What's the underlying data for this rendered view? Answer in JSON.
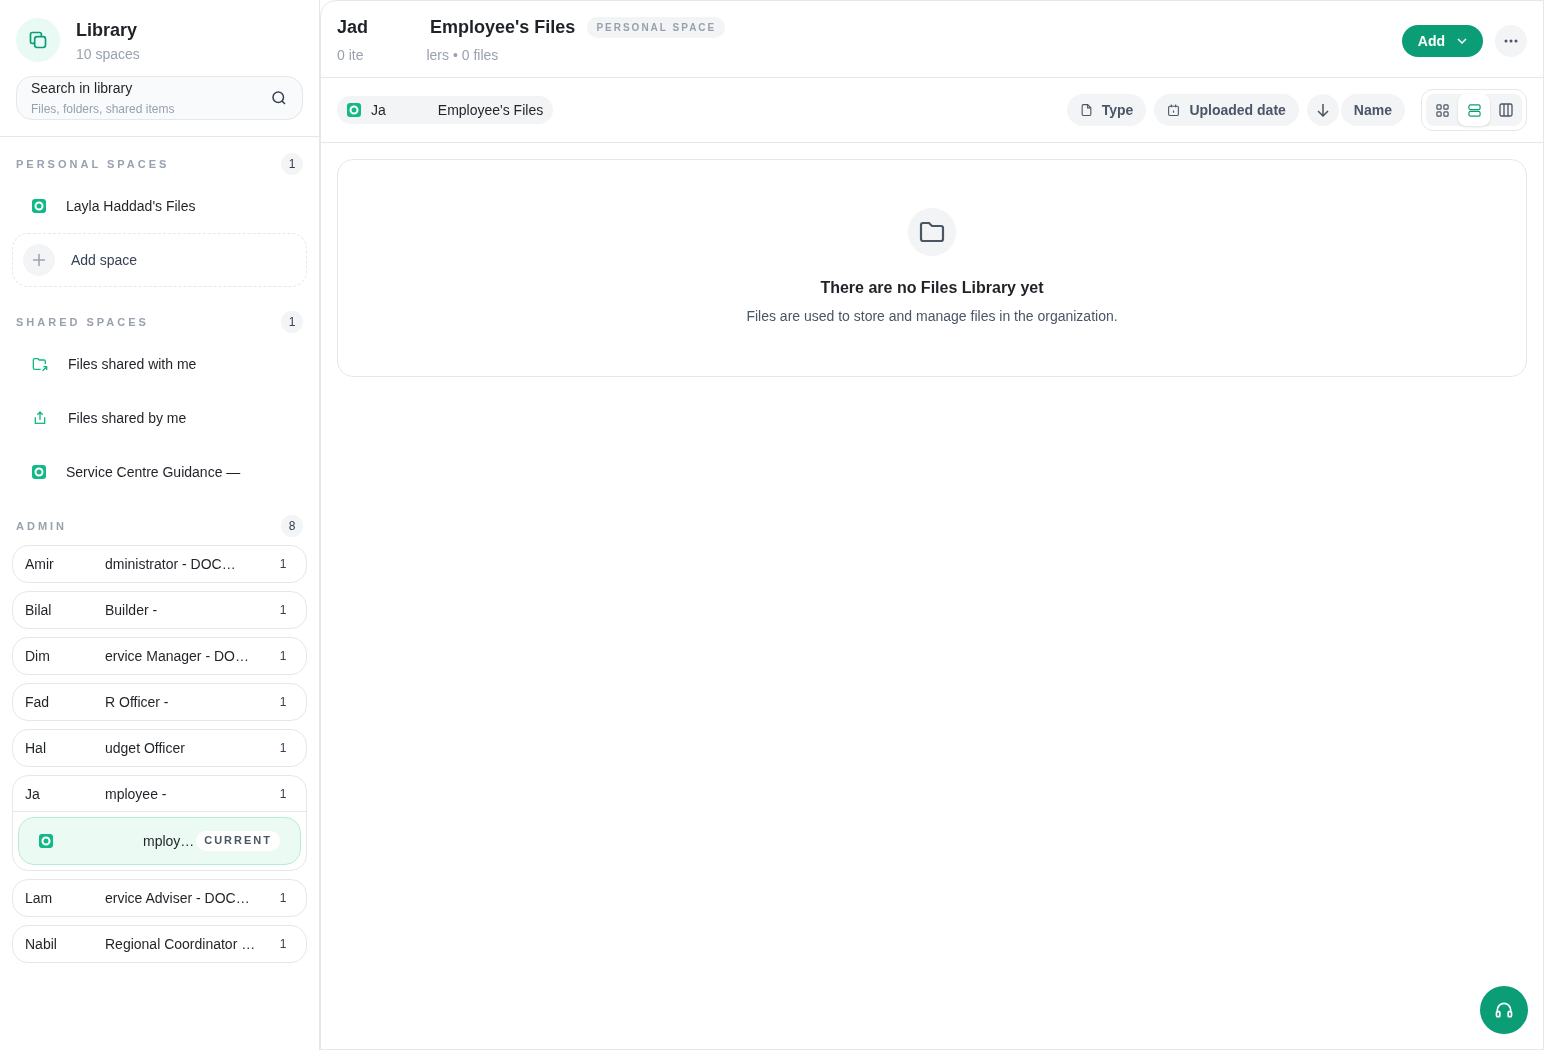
{
  "sidebar": {
    "title": "Library",
    "subtitle": "10 spaces",
    "search": {
      "value": "Search in library",
      "placeholder": "Files, folders, shared items"
    },
    "personal_spaces": {
      "label": "PERSONAL SPACES",
      "count": "1",
      "items": [
        {
          "label": "Layla Haddad's Files",
          "kind": "space"
        }
      ],
      "add_label": "Add space"
    },
    "shared_spaces": {
      "label": "SHARED SPACES",
      "count": "1",
      "items": [
        {
          "label": "Files shared with me",
          "kind": "shared-in"
        },
        {
          "label": "Files shared by me",
          "kind": "shared-out"
        },
        {
          "label": "Service Centre Guidance —",
          "kind": "space"
        }
      ]
    },
    "admin_spaces": {
      "label": "ADMIN",
      "count": "8",
      "items": [
        {
          "name": "Amir",
          "role": "dministrator - DOC…",
          "count": "1"
        },
        {
          "name": "Bilal",
          "role": "Builder -",
          "count": "1"
        },
        {
          "name": "Dim",
          "role": "ervice Manager - DO…",
          "count": "1"
        },
        {
          "name": "Fad",
          "role": "R Officer -",
          "count": "1"
        },
        {
          "name": "Hal",
          "role": "udget Officer",
          "count": "1"
        },
        {
          "name": "Ja",
          "role": "mployee -",
          "count": "1",
          "children": [
            {
              "label": "mploy…",
              "badge": "CURRENT",
              "selected": true
            }
          ]
        },
        {
          "name": "Lam",
          "role": "ervice Adviser - DOC…",
          "count": "1"
        },
        {
          "name": "Nabil",
          "role": "Regional Coordinator …",
          "count": "1"
        }
      ]
    }
  },
  "header": {
    "title_start": "Jad",
    "title_end": "Employee's Files",
    "badge": "PERSONAL SPACE",
    "meta_start": "0 ite",
    "meta_end": "lers • 0 files",
    "add_button": "Add"
  },
  "breadcrumb": {
    "start": "Ja",
    "end": "Employee's Files"
  },
  "toolbar": {
    "filters": [
      {
        "label": "Type",
        "kind": "type"
      },
      {
        "label": "Uploaded date",
        "kind": "date"
      }
    ],
    "sort_field": "Name",
    "views": [
      {
        "kind": "grid",
        "selected": false
      },
      {
        "kind": "list",
        "selected": true
      },
      {
        "kind": "columns",
        "selected": false
      }
    ]
  },
  "empty_state": {
    "title": "There are no Files Library yet",
    "text": "Files are used to store and manage files in the organization."
  }
}
